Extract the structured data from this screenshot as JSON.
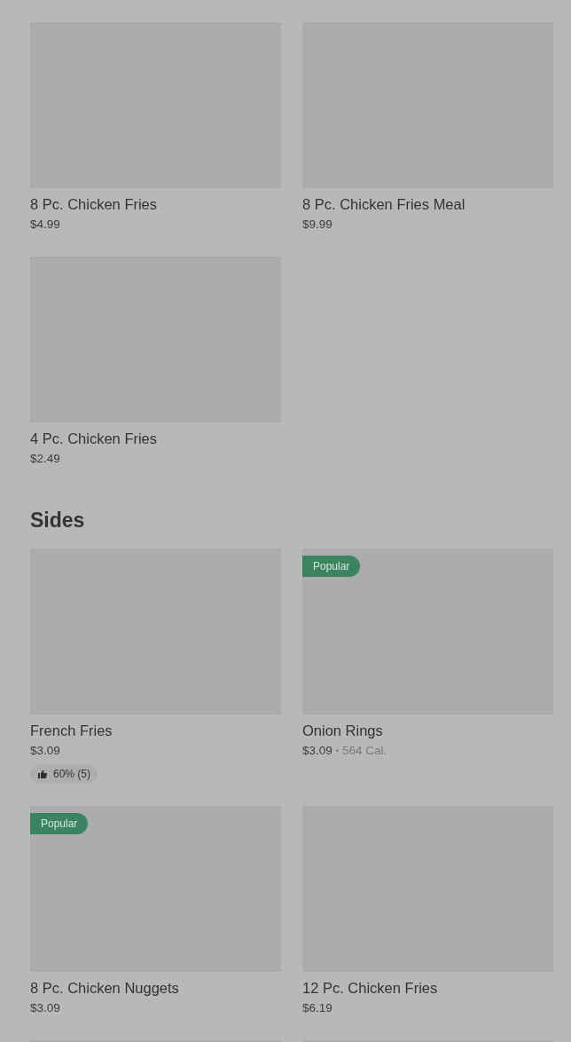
{
  "sections": [
    {
      "items": [
        {
          "kind": "item",
          "name": "8 Pc. Chicken Fries",
          "price": "$4.99"
        },
        {
          "kind": "item",
          "name": "8 Pc. Chicken Fries Meal",
          "price": "$9.99"
        },
        {
          "kind": "item",
          "name": "4 Pc. Chicken Fries",
          "price": "$2.49"
        }
      ]
    },
    {
      "title": "Sides",
      "items": [
        {
          "kind": "item",
          "name": "French Fries",
          "price": "$3.09",
          "rating": "60% (5)"
        },
        {
          "kind": "item",
          "name": "Onion Rings",
          "price": "$3.09",
          "separator": "•",
          "calories": "564 Cal.",
          "badge": "Popular"
        },
        {
          "kind": "item",
          "name": "8 Pc. Chicken Nuggets",
          "price": "$3.09",
          "badge": "Popular"
        },
        {
          "kind": "item",
          "name": "12 Pc. Chicken Fries",
          "price": "$6.19"
        },
        {
          "kind": "image_only"
        },
        {
          "kind": "image_only"
        }
      ]
    }
  ]
}
